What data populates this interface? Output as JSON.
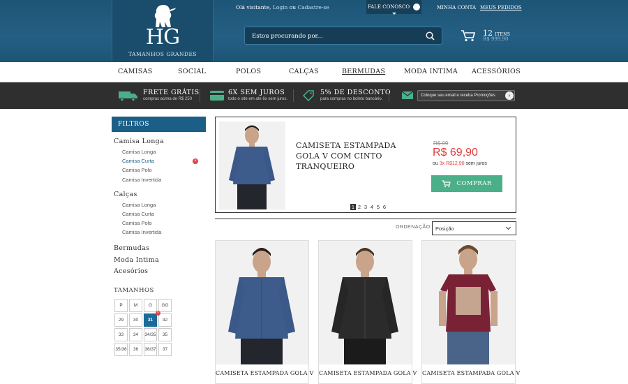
{
  "header": {
    "logo_text": "HG",
    "logo_tagline": "TAMANHOS GRANDES",
    "welcome": "Olá visitante,",
    "login": "Login",
    "or": "ou",
    "register": "Cadastre-se",
    "contact": "FALE CONOSCO",
    "account": "MINHA CONTA",
    "orders": "MEUS PEDIDOS",
    "search_placeholder": "Estou procurando por...",
    "cart_count": "12",
    "cart_items_label": "ITENS",
    "cart_total": "R$ 999,90"
  },
  "nav": {
    "items": [
      "CAMISAS",
      "SOCIAL",
      "POLOS",
      "CALÇAS",
      "BERMUDAS",
      "MODA INTIMA",
      "ACESSÓRIOS"
    ],
    "active": "BERMUDAS"
  },
  "promo": {
    "shipping_title": "FRETE GRÁTIS",
    "shipping_sub": "compras acima de R$ 250",
    "installments_title": "6X SEM JUROS",
    "installments_sub": "todo o site em ate 6x sem juros.",
    "discount_title": "5% DE DESCONTO",
    "discount_sub": "para compras no boleto bancário.",
    "newsletter": "Coloque seu email e receba Promoções"
  },
  "sidebar": {
    "header": "FILTROS",
    "group1": "Camisa Longa",
    "group1_items": [
      "Camisa Longa",
      "Camisa Curta",
      "Camisa Polo",
      "Camisa Invertida"
    ],
    "group1_selected": "Camisa Curta",
    "group2": "Calças",
    "group2_items": [
      "Camisa Longa",
      "Camisa Curta",
      "Camisa Polo",
      "Camisa Invertida"
    ],
    "others": [
      "Bermudas",
      "Moda Intima",
      "Acesórios"
    ],
    "sizes_title": "TAMANHOS",
    "sizes": [
      "P",
      "M",
      "G",
      "GG",
      "29",
      "30",
      "31",
      "32",
      "33",
      "34",
      "34/35",
      "35",
      "35/36",
      "36",
      "36/37",
      "37"
    ],
    "size_selected": "31",
    "remove_mark": "×"
  },
  "featured": {
    "title": "CAMISETA ESTAMPADA GOLA V COM CINTO TRANQUEIRO",
    "old_price": "R$ 99",
    "price": "R$ 69,90",
    "installments_prefix": "ou",
    "installments_value": "3x R$12,90",
    "installments_suffix": "sem juros",
    "buy_label": "COMPRAR",
    "pages": [
      "1",
      "2",
      "3",
      "4",
      "5",
      "6"
    ],
    "current_page": "1"
  },
  "sort": {
    "label": "ORDENAÇÃO",
    "value": "Posição"
  },
  "products": [
    {
      "name": "CAMISETA ESTAMPADA GOLA V",
      "shirt_color": "#3d5c8c"
    },
    {
      "name": "CAMISETA ESTAMPADA GOLA V",
      "shirt_color": "#2b2b2b"
    },
    {
      "name": "CAMISETA ESTAMPADA GOLA V",
      "shirt_color": "#7a2235"
    }
  ],
  "colors": {
    "header_bg": "#1d5577",
    "accent": "#1b5f88",
    "price_red": "#e23b3b",
    "buy_green": "#4bb08a",
    "promo_bg": "#2f2f2f"
  }
}
